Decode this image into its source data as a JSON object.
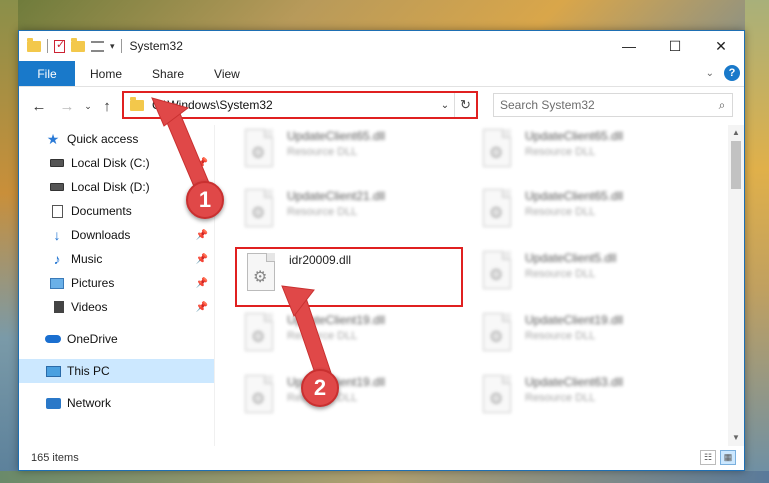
{
  "window": {
    "title": "System32"
  },
  "title_controls": {
    "minimize": "—",
    "maximize": "☐",
    "close": "✕"
  },
  "ribbon": {
    "tabs": [
      "File",
      "Home",
      "Share",
      "View"
    ],
    "expand": "⌄",
    "help": "?"
  },
  "nav": {
    "back": "←",
    "forward": "→",
    "recent": "⌄",
    "up": "↑",
    "address": "C:\\Windows\\System32",
    "address_dropdown": "⌄",
    "refresh": "↻",
    "search_placeholder": "Search System32",
    "search_glyph": "⌕"
  },
  "sidebar": {
    "items": [
      {
        "label": "Quick access",
        "icon": "star-icon",
        "pinned": false
      },
      {
        "label": "Local Disk (C:)",
        "icon": "disk-icon",
        "pinned": true
      },
      {
        "label": "Local Disk (D:)",
        "icon": "disk-icon",
        "pinned": false
      },
      {
        "label": "Documents",
        "icon": "documents-icon",
        "pinned": false
      },
      {
        "label": "Downloads",
        "icon": "downloads-icon",
        "pinned": true
      },
      {
        "label": "Music",
        "icon": "music-icon",
        "pinned": true
      },
      {
        "label": "Pictures",
        "icon": "pictures-icon",
        "pinned": true
      },
      {
        "label": "Videos",
        "icon": "videos-icon",
        "pinned": true
      },
      {
        "label": "OneDrive",
        "icon": "onedrive-icon",
        "pinned": false
      },
      {
        "label": "This PC",
        "icon": "this-pc-icon",
        "pinned": false,
        "selected": true
      },
      {
        "label": "Network",
        "icon": "network-icon",
        "pinned": false
      }
    ],
    "pin_glyph": "📌"
  },
  "files": [
    {
      "name": "UpdateClient65.dll",
      "type": "Resource DLL",
      "blurred": true
    },
    {
      "name": "UpdateClient65.dll",
      "type": "Resource DLL",
      "blurred": true
    },
    {
      "name": "UpdateClient21.dll",
      "type": "Resource DLL",
      "blurred": true
    },
    {
      "name": "UpdateClient65.dll",
      "type": "Resource DLL",
      "blurred": true
    },
    {
      "name": "idr20009.dll",
      "type": "",
      "blurred": false,
      "highlighted": true
    },
    {
      "name": "UpdateClient5.dll",
      "type": "Resource DLL",
      "blurred": true
    },
    {
      "name": "UpdateClient19.dll",
      "type": "Resource DLL",
      "blurred": true
    },
    {
      "name": "UpdateClient19.dll",
      "type": "Resource DLL",
      "blurred": true
    },
    {
      "name": "UpdateClient19.dll",
      "type": "Resource DLL",
      "blurred": true
    },
    {
      "name": "UpdateClient63.dll",
      "type": "Resource DLL",
      "blurred": true
    }
  ],
  "status": {
    "item_count": "165 items"
  },
  "view_buttons": {
    "details": "☷",
    "tiles": "▦"
  },
  "callouts": {
    "one": "1",
    "two": "2"
  },
  "colors": {
    "accent": "#1979ca",
    "highlight_border": "#e02020",
    "callout": "#e04848"
  }
}
